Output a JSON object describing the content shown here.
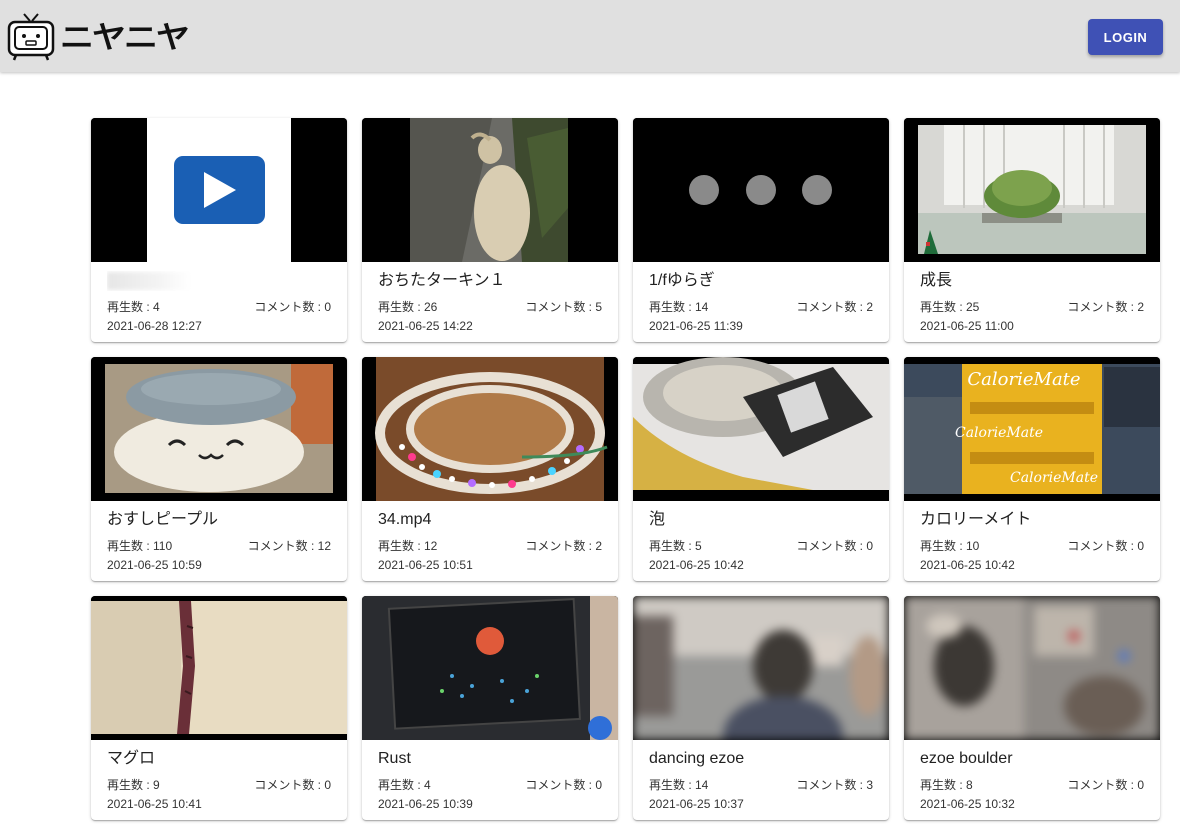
{
  "header": {
    "logo_text": "ニヤニヤ",
    "login_label": "LOGIN",
    "brand_color": "#3f51b5"
  },
  "videos": [
    {
      "title": "",
      "views_label": "再生数 : 4",
      "comments_label": "コメント数 : 0",
      "date": "2021-06-28 12:27",
      "thumbnail": "play-placeholder"
    },
    {
      "title": "おちたターキン１",
      "views_label": "再生数 : 26",
      "comments_label": "コメント数 : 5",
      "date": "2021-06-25 14:22",
      "thumbnail": "takin-on-rocks"
    },
    {
      "title": "1/fゆらぎ",
      "views_label": "再生数 : 14",
      "comments_label": "コメント数 : 2",
      "date": "2021-06-25 11:39",
      "thumbnail": "loading-dots"
    },
    {
      "title": "成長",
      "views_label": "再生数 : 25",
      "comments_label": "コメント数 : 2",
      "date": "2021-06-25 11:00",
      "thumbnail": "sprouts-tray"
    },
    {
      "title": "おすしピープル",
      "views_label": "再生数 : 110",
      "comments_label": "コメント数 : 12",
      "date": "2021-06-25 10:59",
      "thumbnail": "sushi-plush"
    },
    {
      "title": "34.mp4",
      "views_label": "再生数 : 12",
      "comments_label": "コメント数 : 2",
      "date": "2021-06-25 10:51",
      "thumbnail": "led-strip"
    },
    {
      "title": "泡",
      "views_label": "再生数 : 5",
      "comments_label": "コメント数 : 0",
      "date": "2021-06-25 10:42",
      "thumbnail": "beer-can-foam"
    },
    {
      "title": "カロリーメイト",
      "views_label": "再生数 : 10",
      "comments_label": "コメント数 : 0",
      "date": "2021-06-25 10:42",
      "thumbnail": "calorie-mate-boxes"
    },
    {
      "title": "マグロ",
      "views_label": "再生数 : 9",
      "comments_label": "コメント数 : 0",
      "date": "2021-06-25 10:41",
      "thumbnail": "tuna-slice"
    },
    {
      "title": "Rust",
      "views_label": "再生数 : 4",
      "comments_label": "コメント数 : 0",
      "date": "2021-06-25 10:39",
      "thumbnail": "display-panel"
    },
    {
      "title": "dancing ezoe",
      "views_label": "再生数 : 14",
      "comments_label": "コメント数 : 3",
      "date": "2021-06-25 10:37",
      "thumbnail": "climbing-gym-blurred"
    },
    {
      "title": "ezoe boulder",
      "views_label": "再生数 : 8",
      "comments_label": "コメント数 : 0",
      "date": "2021-06-25 10:32",
      "thumbnail": "bouldering-blurred"
    }
  ]
}
